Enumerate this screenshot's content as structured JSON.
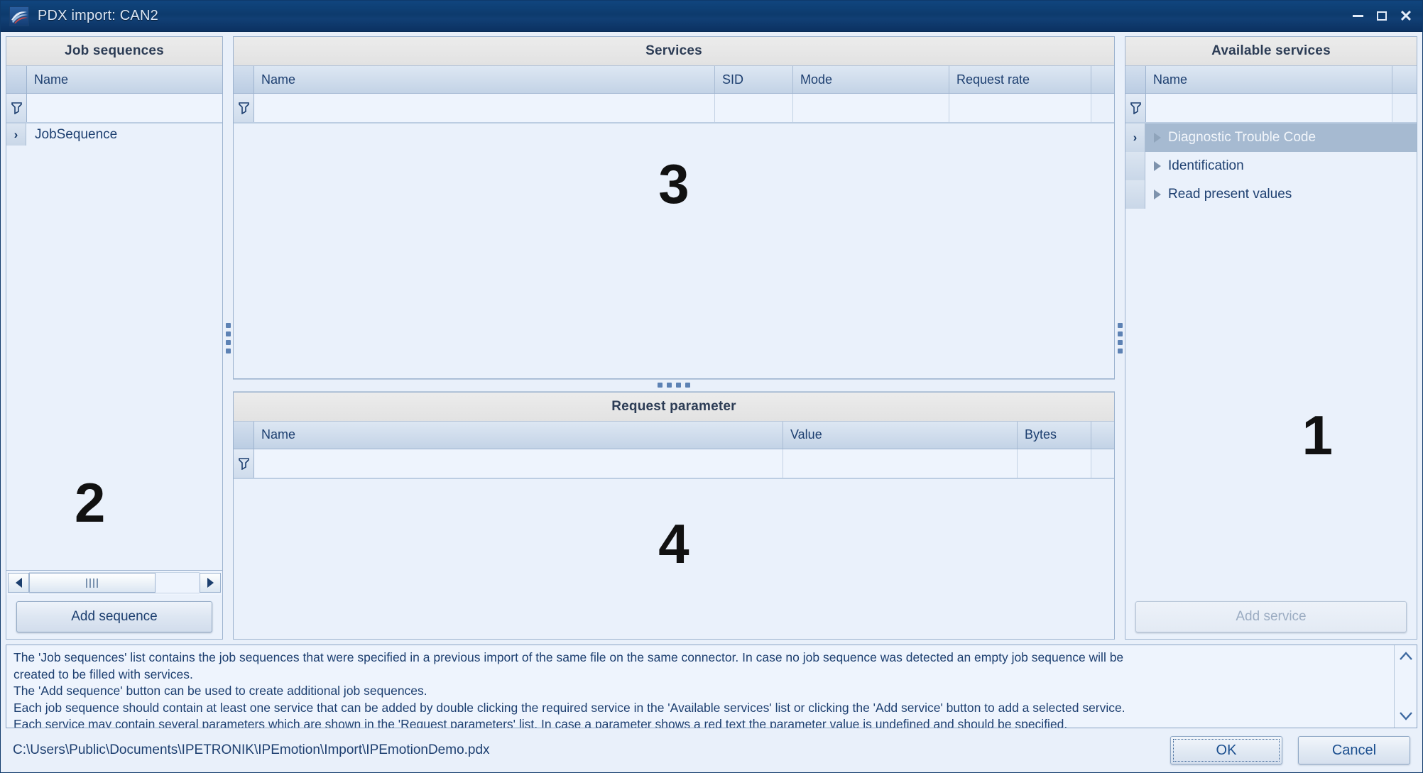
{
  "window": {
    "title": "PDX import: CAN2",
    "icon": "app-logo-icon",
    "controls": {
      "minimize": "–",
      "maximize": "□",
      "close": "✕"
    }
  },
  "job_sequences": {
    "caption": "Job sequences",
    "watermark": "2",
    "columns": [
      "Name"
    ],
    "filter_icon": "filter-funnel-icon",
    "rows": [
      {
        "expander": "›",
        "name": "JobSequence"
      }
    ],
    "add_button": "Add sequence",
    "hscroll": {
      "left_arrow": "◄",
      "right_arrow": "►"
    }
  },
  "services": {
    "caption": "Services",
    "watermark": "3",
    "columns": [
      "Name",
      "SID",
      "Mode",
      "Request rate"
    ],
    "filter_icon": "filter-funnel-icon",
    "rows": []
  },
  "request_parameter": {
    "caption": "Request parameter",
    "watermark": "4",
    "columns": [
      "Name",
      "Value",
      "Bytes"
    ],
    "filter_icon": "filter-funnel-icon",
    "rows": []
  },
  "available_services": {
    "caption": "Available services",
    "watermark": "1",
    "columns": [
      "Name"
    ],
    "filter_icon": "filter-funnel-icon",
    "rows": [
      {
        "expander": "›",
        "name": "Diagnostic Trouble Code",
        "selected": true
      },
      {
        "expander": "",
        "name": "Identification",
        "selected": false
      },
      {
        "expander": "",
        "name": "Read present values",
        "selected": false
      }
    ],
    "add_button": "Add service",
    "add_button_enabled": false
  },
  "help": {
    "lines": [
      "The 'Job sequences' list contains the job sequences that were specified in a previous import of the same file on the same connector. In case no job sequence was detected an empty job sequence will be",
      "created to be filled with services.",
      "The 'Add sequence' button can be used to create additional job sequences.",
      "Each job sequence should contain at least one service that can be added by double clicking the required service in the 'Available services' list or clicking the 'Add service' button to add a selected service.",
      "Each service may contain several parameters which are shown in the 'Request parameters' list. In case a parameter shows a red text the parameter value is undefined and should be specified."
    ],
    "scroll_up": "⌃",
    "scroll_down": "⌄"
  },
  "statusbar": {
    "path": "C:\\Users\\Public\\Documents\\IPETRONIK\\IPEmotion\\Import\\IPEmotionDemo.pdx",
    "ok_label": "OK",
    "cancel_label": "Cancel"
  },
  "colors": {
    "titlebar": "#0d3b6d",
    "panel_bg": "#eaf1fb",
    "caption_bg": "#e7e7e7",
    "header_blue": "#c3d3e6",
    "selection": "#a6bad1",
    "text_blue": "#1d3f70"
  }
}
